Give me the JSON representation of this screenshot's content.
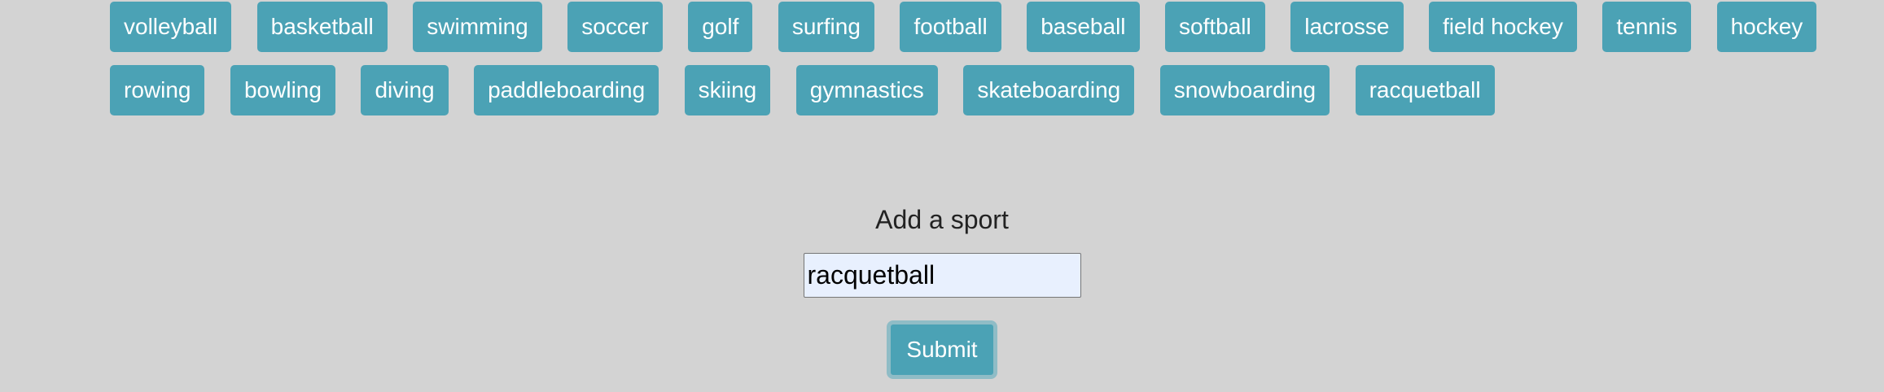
{
  "sports": [
    "volleyball",
    "basketball",
    "swimming",
    "soccer",
    "golf",
    "surfing",
    "football",
    "baseball",
    "softball",
    "lacrosse",
    "field hockey",
    "tennis",
    "hockey",
    "rowing",
    "bowling",
    "diving",
    "paddleboarding",
    "skiing",
    "gymnastics",
    "skateboarding",
    "snowboarding",
    "racquetball"
  ],
  "form": {
    "label": "Add a sport",
    "input_value": "racquetball",
    "submit_label": "Submit"
  },
  "colors": {
    "background": "#d3d3d3",
    "tag_background": "#4ba2b5",
    "tag_text": "#ffffff",
    "input_background": "#e8f0fe"
  }
}
